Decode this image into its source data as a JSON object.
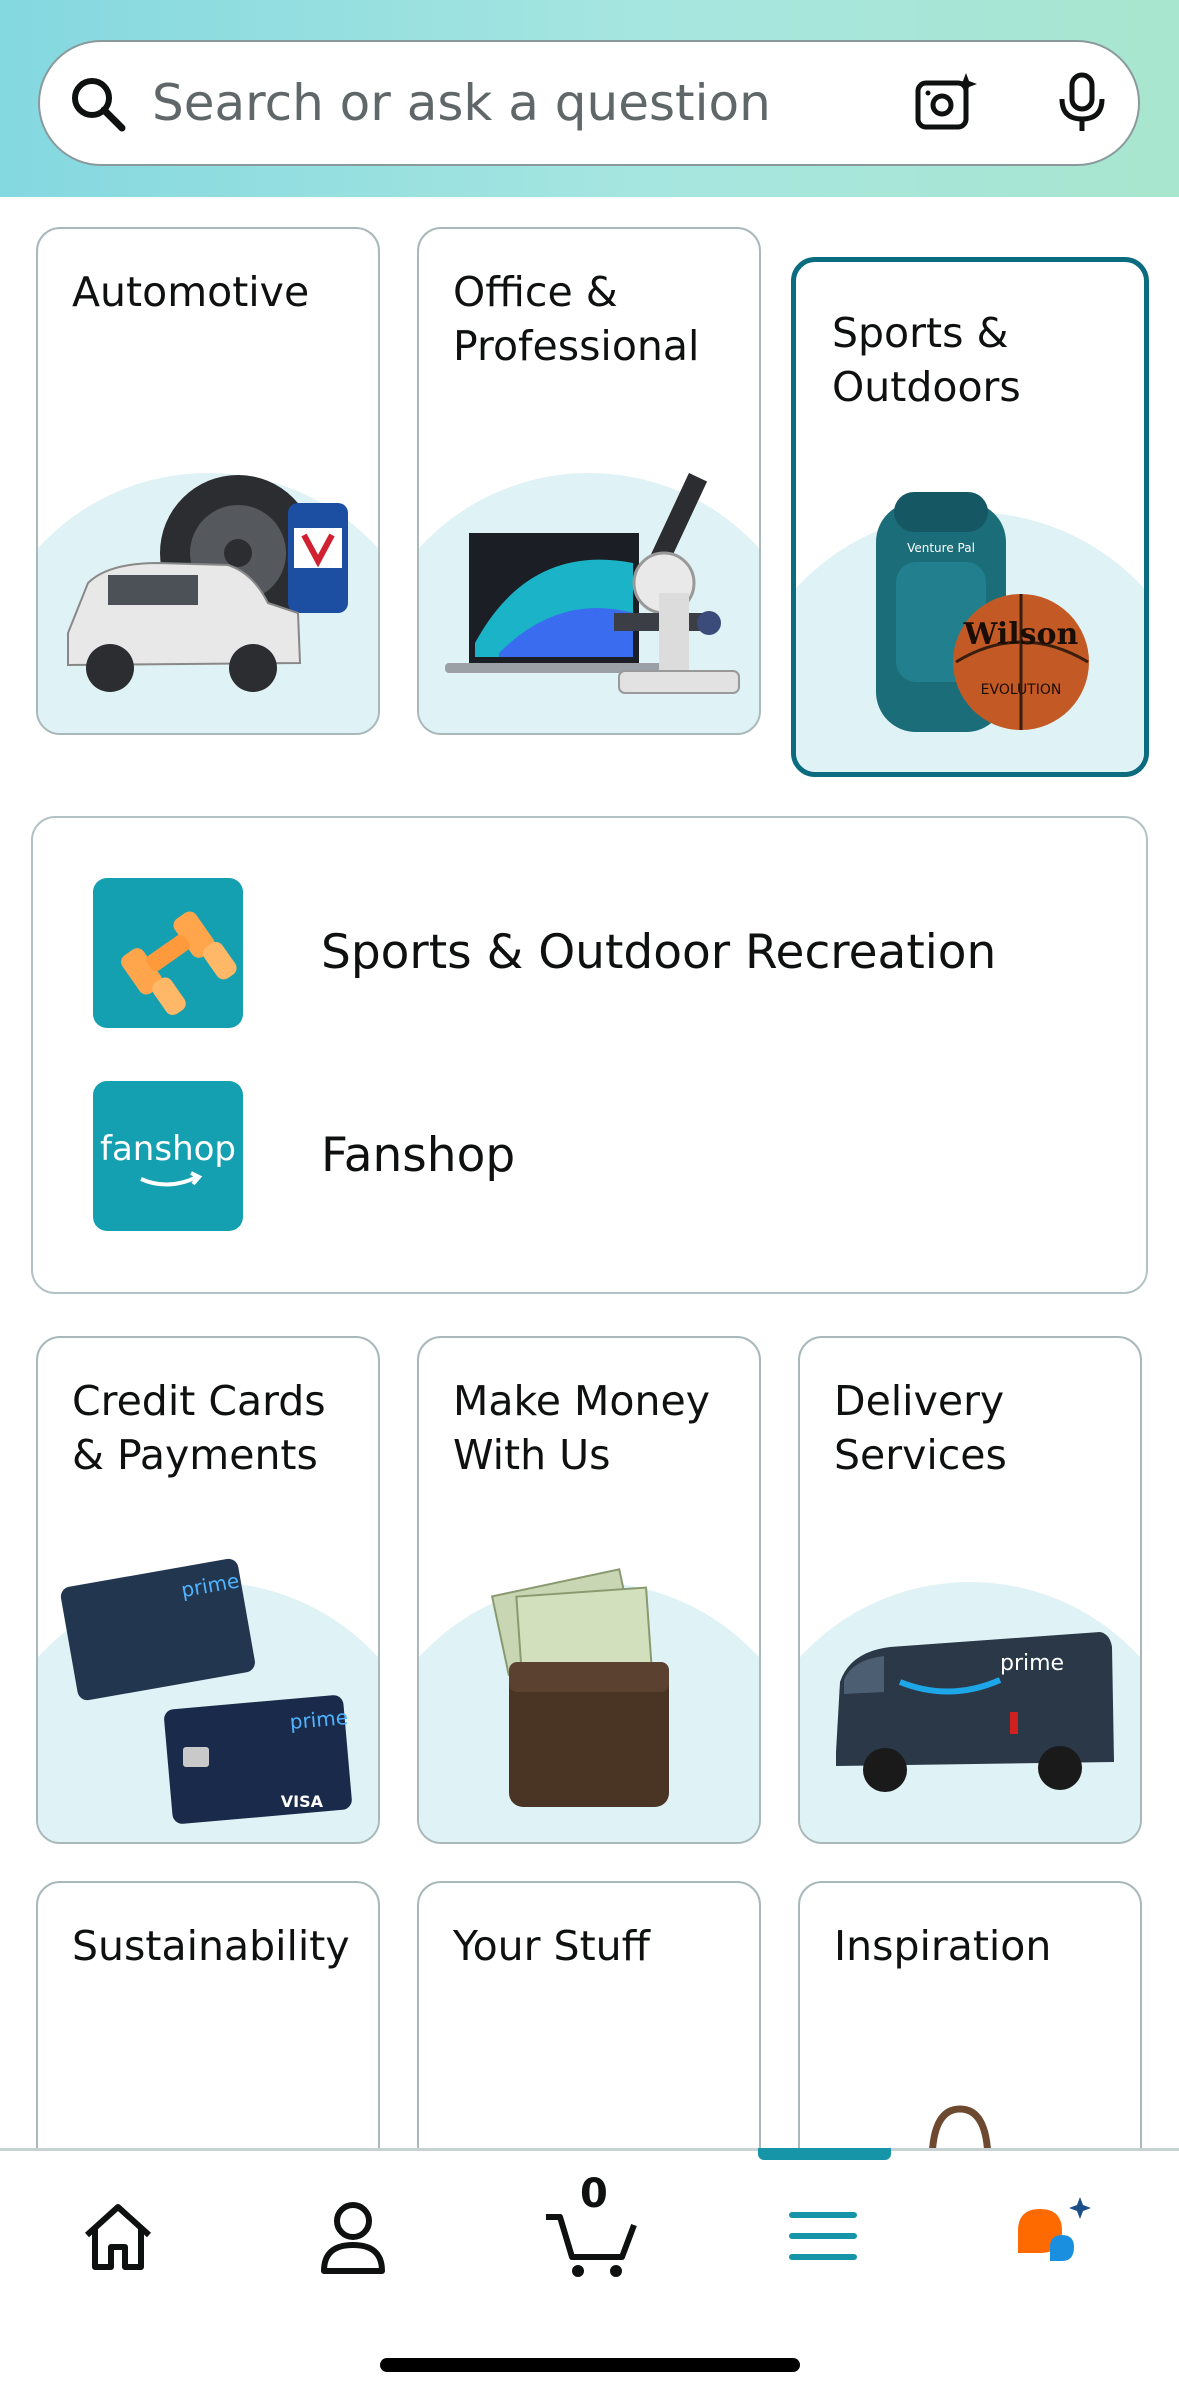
{
  "search": {
    "placeholder": "Search or ask a question",
    "icons": [
      "search-icon",
      "camera-sparkle-icon",
      "microphone-icon"
    ]
  },
  "tiles_row1": [
    {
      "label": "Automotive"
    },
    {
      "label": "Office &\nProfessional"
    },
    {
      "label": "Sports &\nOutdoors",
      "selected": true
    }
  ],
  "subcategories": [
    {
      "label": "Sports & Outdoor Recreation",
      "icon": "dumbbell-icon"
    },
    {
      "label": "Fanshop",
      "logo_text": "fanshop"
    }
  ],
  "tiles_row2": [
    {
      "label": "Credit Cards\n& Payments"
    },
    {
      "label": "Make Money\nWith Us"
    },
    {
      "label": "Delivery\nServices"
    }
  ],
  "tiles_row3": [
    {
      "label": "Sustainability"
    },
    {
      "label": "Your Stuff"
    },
    {
      "label": "Inspiration"
    }
  ],
  "bottom_nav": {
    "items": [
      "home-icon",
      "account-icon",
      "cart-icon",
      "menu-icon",
      "rufus-icon"
    ],
    "cart_count": "0",
    "active": "menu",
    "accent": "#1795a8"
  },
  "colors": {
    "selected_border": "#0b6b7f",
    "tile_border": "#a9b9bb",
    "image_backdrop": "#dff2f5"
  }
}
